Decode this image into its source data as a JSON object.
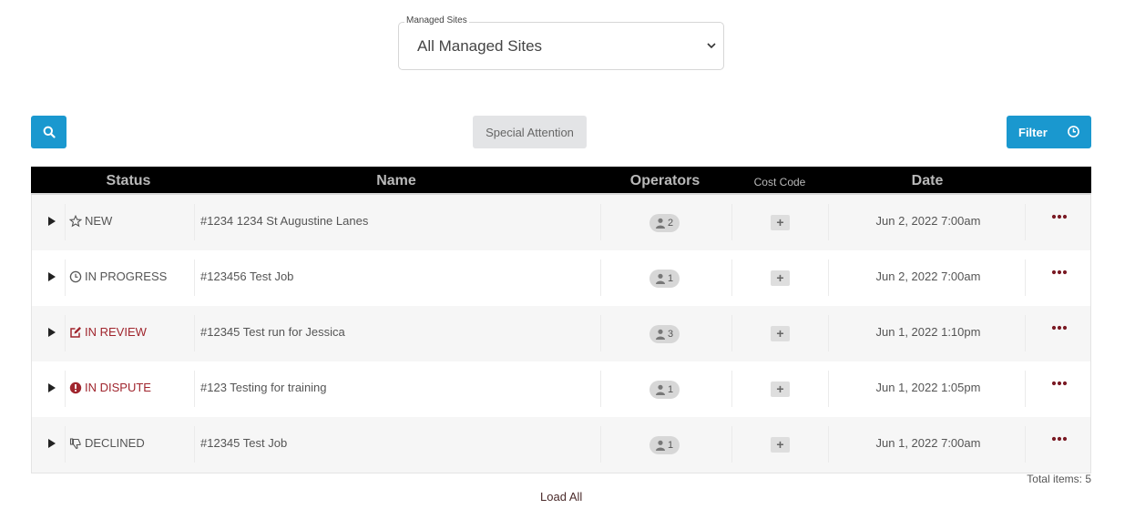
{
  "site_select": {
    "legend": "Managed Sites",
    "value": "All Managed Sites"
  },
  "toolbar": {
    "search_icon": "search-icon",
    "special_label": "Special Attention",
    "filter_label": "Filter",
    "filter_icon": "clock-icon",
    "accent_color": "#1a98cf"
  },
  "table": {
    "headers": {
      "status": "Status",
      "name": "Name",
      "operators": "Operators",
      "cost_code": "Cost Code",
      "date": "Date"
    },
    "rows": [
      {
        "status": "NEW",
        "status_icon": "star-outline-icon",
        "name": "#1234 1234 St Augustine Lanes",
        "operators": "2",
        "cost_code": "+",
        "date": "Jun 2, 2022 7:00am"
      },
      {
        "status": "IN PROGRESS",
        "status_icon": "clock-icon",
        "name": "#123456 Test Job",
        "operators": "1",
        "cost_code": "+",
        "date": "Jun 2, 2022 7:00am"
      },
      {
        "status": "IN REVIEW",
        "status_icon": "edit-square-icon",
        "name": "#12345 Test run for Jessica",
        "operators": "3",
        "cost_code": "+",
        "date": "Jun 1, 2022 1:10pm"
      },
      {
        "status": "IN DISPUTE",
        "status_icon": "exclamation-circle-icon",
        "name": "#123 Testing for training",
        "operators": "1",
        "cost_code": "+",
        "date": "Jun 1, 2022 1:05pm"
      },
      {
        "status": "DECLINED",
        "status_icon": "thumbs-down-icon",
        "name": "#12345 Test Job",
        "operators": "1",
        "cost_code": "+",
        "date": "Jun 1, 2022 7:00am"
      }
    ]
  },
  "footer": {
    "total_label": "Total items: 5",
    "load_all": "Load All"
  },
  "colors": {
    "status_red": "#a0262e",
    "header_bg": "#000000",
    "more_dots": "#7a1a24"
  }
}
